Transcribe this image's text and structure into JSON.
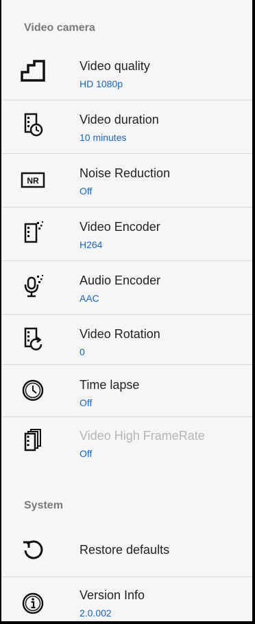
{
  "sections": {
    "video_camera": "Video camera",
    "system": "System"
  },
  "items": [
    {
      "title": "Video quality",
      "summary": "HD 1080p",
      "icon": "stairs-quality-icon"
    },
    {
      "title": "Video duration",
      "summary": "10 minutes",
      "icon": "film-timer-icon"
    },
    {
      "title": "Noise Reduction",
      "summary": "Off",
      "icon": "nr-badge-icon"
    },
    {
      "title": "Video Encoder",
      "summary": "H264",
      "icon": "film-dots-icon"
    },
    {
      "title": "Audio Encoder",
      "summary": "AAC",
      "icon": "mic-dots-icon"
    },
    {
      "title": "Video Rotation",
      "summary": "0",
      "icon": "film-rotate-icon"
    },
    {
      "title": "Time lapse",
      "summary": "Off",
      "icon": "clock-icon"
    },
    {
      "title": "Video High FrameRate",
      "summary": "Off",
      "icon": "film-stack-icon"
    }
  ],
  "system_items": [
    {
      "title": "Restore defaults",
      "icon": "restore-icon"
    },
    {
      "title": "Version Info",
      "summary": "2.0.002",
      "icon": "info-icon"
    }
  ],
  "colors": {
    "background": "#f6f6f6",
    "accent": "#1565c0",
    "header": "#7a7a7a",
    "disabled": "#b5b5b5"
  }
}
